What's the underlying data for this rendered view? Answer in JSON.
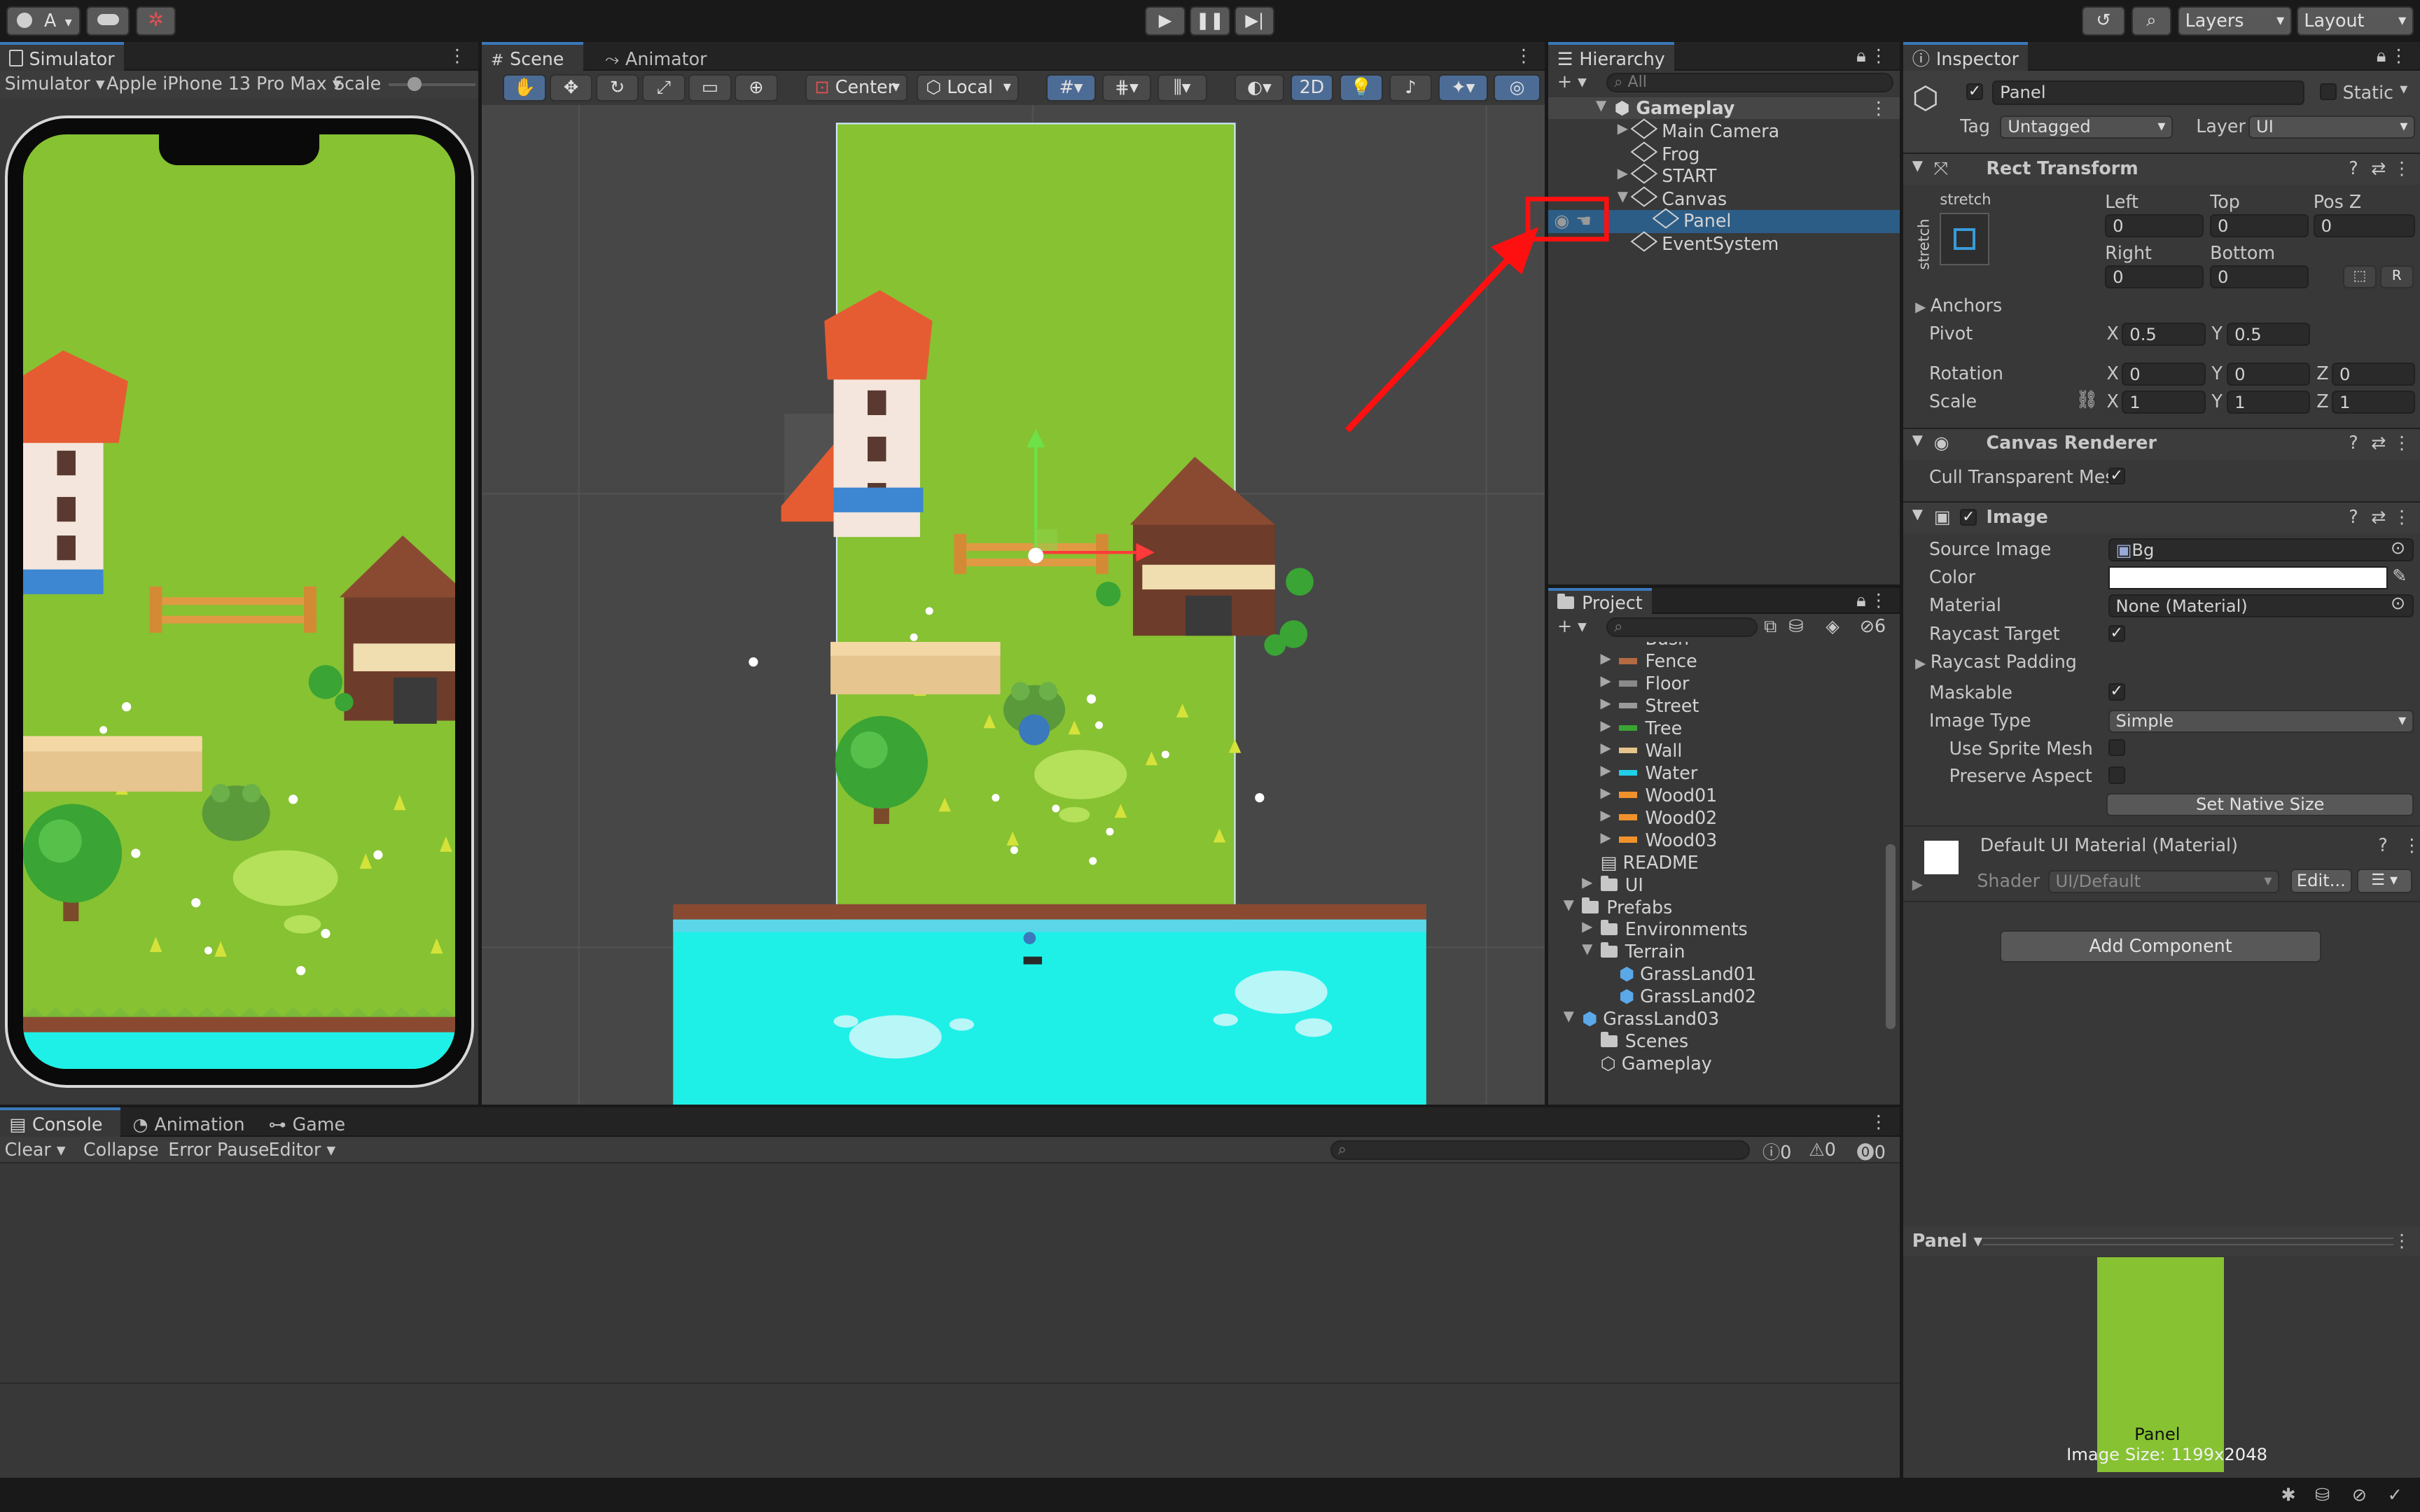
{
  "toolbar": {
    "account": "A",
    "layers": "Layers",
    "layout": "Layout"
  },
  "simulator": {
    "tab": "Simulator",
    "mode": "Simulator",
    "device": "Apple iPhone 13 Pro Max",
    "scale_label": "Scale"
  },
  "scene": {
    "tabs": [
      "Scene",
      "Animator"
    ],
    "pivot": "Center",
    "space": "Local",
    "mode_2d": "2D"
  },
  "hierarchy": {
    "tab": "Hierarchy",
    "search_placeholder": "All",
    "items": [
      "Gameplay",
      "Main Camera",
      "Frog",
      "START",
      "Canvas",
      "Panel",
      "EventSystem"
    ]
  },
  "project": {
    "tab": "Project",
    "hidden_count": "6",
    "items": [
      {
        "name": "Bush",
        "color": "#3aa435"
      },
      {
        "name": "Fence",
        "color": "#b46a42"
      },
      {
        "name": "Floor",
        "color": "#8a8a8a"
      },
      {
        "name": "Street",
        "color": "#9a9a9a"
      },
      {
        "name": "Tree",
        "color": "#3aa435"
      },
      {
        "name": "Wall",
        "color": "#e4c48c"
      },
      {
        "name": "Water",
        "color": "#20d0e8"
      },
      {
        "name": "Wood01",
        "color": "#f0922b"
      },
      {
        "name": "Wood02",
        "color": "#f0922b"
      },
      {
        "name": "Wood03",
        "color": "#f0922b"
      },
      {
        "name": "README",
        "color": ""
      },
      {
        "name": "UI",
        "color": ""
      },
      {
        "name": "Prefabs",
        "color": ""
      },
      {
        "name": "Environments",
        "color": ""
      },
      {
        "name": "Terrain",
        "color": ""
      },
      {
        "name": "GrassLand01",
        "color": ""
      },
      {
        "name": "GrassLand02",
        "color": ""
      },
      {
        "name": "GrassLand03",
        "color": ""
      },
      {
        "name": "Scenes",
        "color": ""
      },
      {
        "name": "Gameplay",
        "color": ""
      }
    ]
  },
  "inspector": {
    "tab": "Inspector",
    "object_name": "Panel",
    "static_label": "Static",
    "tag_label": "Tag",
    "tag_value": "Untagged",
    "layer_label": "Layer",
    "layer_value": "UI",
    "rect_transform": {
      "title": "Rect Transform",
      "anchor_preset": "stretch",
      "left_label": "Left",
      "left": "0",
      "top_label": "Top",
      "top": "0",
      "posz_label": "Pos Z",
      "posz": "0",
      "right_label": "Right",
      "right": "0",
      "bottom_label": "Bottom",
      "bottom": "0",
      "anchors": "Anchors",
      "pivot_label": "Pivot",
      "pivot_x": "0.5",
      "pivot_y": "0.5",
      "rotation_label": "Rotation",
      "rot_x": "0",
      "rot_y": "0",
      "rot_z": "0",
      "scale_label": "Scale",
      "scale_x": "1",
      "scale_y": "1",
      "scale_z": "1",
      "r_button": "R"
    },
    "canvas_renderer": {
      "title": "Canvas Renderer",
      "cull_label": "Cull Transparent Mesh"
    },
    "image": {
      "title": "Image",
      "source_label": "Source Image",
      "source_value": "Bg",
      "color_label": "Color",
      "material_label": "Material",
      "material_value": "None (Material)",
      "raycast_target": "Raycast Target",
      "raycast_padding": "Raycast Padding",
      "maskable": "Maskable",
      "image_type_label": "Image Type",
      "image_type_value": "Simple",
      "use_sprite_mesh": "Use Sprite Mesh",
      "preserve_aspect": "Preserve Aspect",
      "set_native_size": "Set Native Size"
    },
    "material": {
      "name": "Default UI Material (Material)",
      "shader_label": "Shader",
      "shader_value": "UI/Default",
      "edit": "Edit..."
    },
    "add_component": "Add Component"
  },
  "preview": {
    "title": "Panel",
    "caption": "Panel",
    "size": "Image Size: 1199x2048"
  },
  "console": {
    "tabs": [
      "Console",
      "Animation",
      "Game"
    ],
    "clear": "Clear",
    "collapse": "Collapse",
    "error_pause": "Error Pause",
    "editor": "Editor",
    "log_count": "0",
    "warn_count": "0",
    "error_count": "0"
  },
  "colors": {
    "accent": "#3a79bb",
    "grass": "#86c232",
    "water": "#1ef0e8",
    "annotation": "#ff1010"
  }
}
